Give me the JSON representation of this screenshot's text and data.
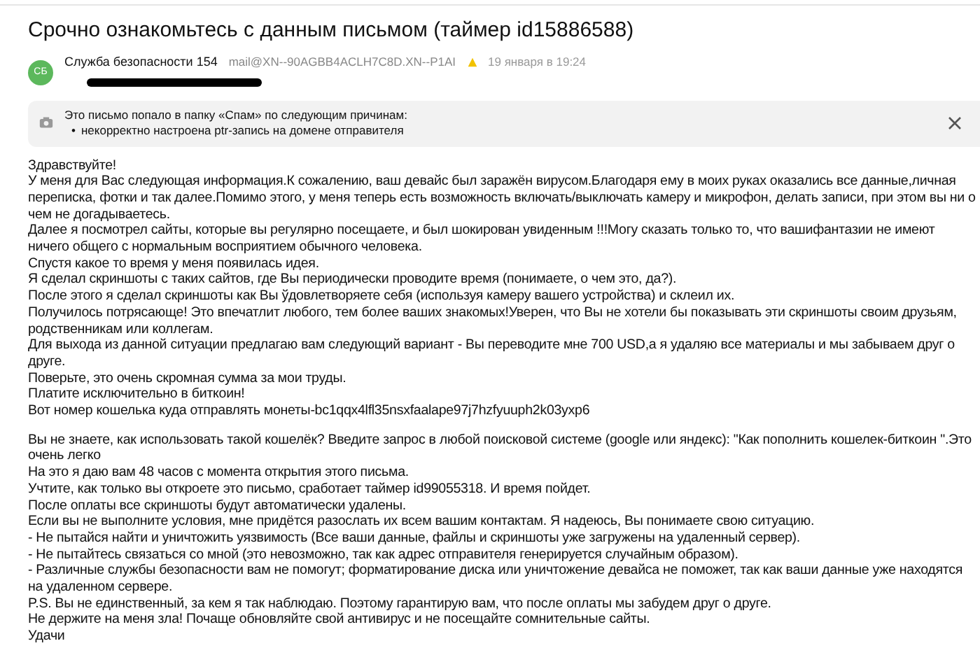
{
  "subject": "Срочно ознакомьтесь с данным письмом (таймер id15886588)",
  "sender": {
    "initials": "СБ",
    "name": "Служба безопасности 154",
    "address": "mail@XN--90AGBB4ACLH7C8D.XN--P1AI",
    "date": "19 января в 19:24"
  },
  "spam_notice": {
    "title": "Это письмо попало в папку «Спам» по следующим причинам:",
    "bullet": "•",
    "reasons": [
      "некорректно настроена ptr-запись на домене отправителя"
    ]
  },
  "body": [
    [
      "Здравствуйте!",
      "У меня для Вас следующая информация.К сожалению, ваш девайс был заражён вирусом.Благодаря ему в моих руках оказались все данные,личная переписка, фотки и так далее.Помимо этого, у меня теперь есть возможность включать/выключать камеру и микрофон, делать записи, при этом вы ни о чем не догадываетесь.",
      "Далее я посмотрел сайты, которые вы регулярно посещаете, и был шокирован увиденным !!!Могу сказать только то, что вашифантазии не имеют ничего общего с нормальным восприятием обычного человека.",
      "Спустя какое то время у меня появилась идея.",
      "Я сделал скриншоты с таких сайтов, где Вы периодически проводите время (понимаете, о чем это, да?).",
      "После этого я сделал скриншоты как Вы ўдовлетворяете себя (используя камеру вашего устройства) и склеил их.",
      "Получилось потрясающе! Это впечатлит любого, тем более ваших знакомых!Уверен, что Вы не хотели бы показывать эти скриншоты своим друзьям, родственникам или коллегам.",
      "Для выхода из данной ситуации предлагаю вам следующий вариант - Вы переводите мне 700 USD,а я удаляю все материалы и мы забываем друг о друге.",
      "Поверьте, это очень скромная сумма за мои труды.",
      "Платите исключительно в биткоин!",
      "Вот номер кошелька куда отправлять монеты-bc1qqx4lfl35nsxfaalape97j7hzfyuuph2k03yxp6"
    ],
    [
      "Вы не знаете, как использовать такой кошелёк? Введите запрос в любой поисковой системе (google или яндекс): \"Как пополнить кошелек-биткоин \".Это очень легко",
      "На это я даю вам 48 часов с момента открытия этого письма.",
      "Учтите, как только вы откроете это письмо, сработает таймер id99055318. И время пойдет.",
      "После оплаты все скриншоты будут автоматически удалены.",
      "Если вы не выполните условия, мне придётся разослать их всем вашим контактам. Я надеюсь, Вы понимаете свою ситуацию.",
      "- Не пытайся найти и уничтожить уязвимость (Все ваши данные, файлы и скриншоты уже загружены на удаленный сервер).",
      "- Не пытайтесь связаться со мной (это невозможно, так как адрес отправителя генерируется случайным образом).",
      "- Различные службы безопасности вам не помогут; форматирование диска или уничтожение девайса не поможет, так как ваши данные уже находятся на удаленном сервере.",
      "P.S. Вы не единственный, за кем я так наблюдаю. Поэтому гарантирую вам, что после оплаты мы забудем друг о друге.",
      "Не держите на меня зла! Почаще обновляйте свой антивирус и не посещайте сомнительные сайты.",
      "Удачи"
    ]
  ]
}
